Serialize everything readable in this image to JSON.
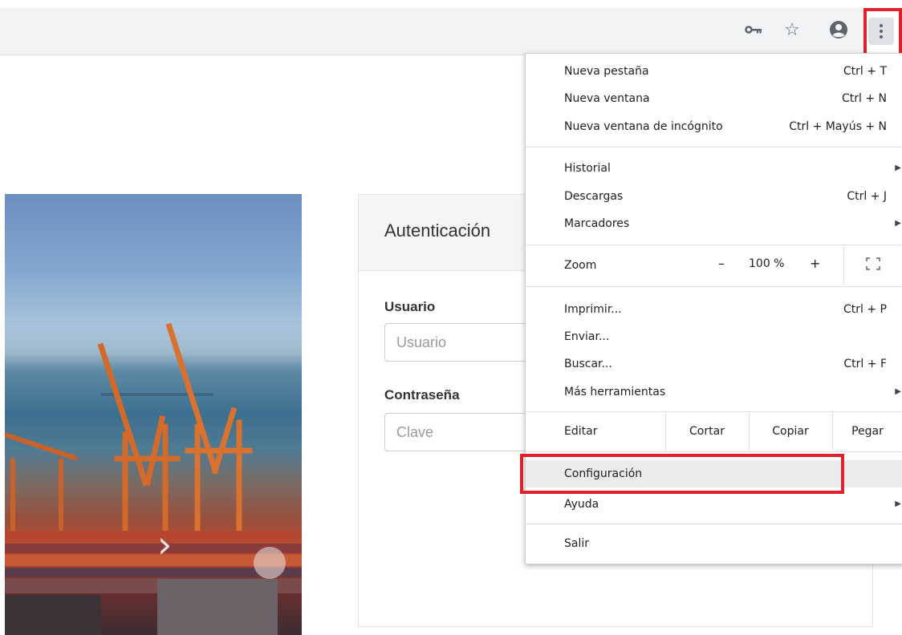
{
  "browser": {
    "icons": [
      "key-icon",
      "star-icon",
      "account-icon",
      "more-vert-icon"
    ]
  },
  "login": {
    "title": "Autenticación",
    "user_label": "Usuario",
    "user_placeholder": "Usuario",
    "password_label": "Contraseña",
    "password_placeholder": "Clave"
  },
  "menu": {
    "new_tab": "Nueva pestaña",
    "new_tab_sc": "Ctrl + T",
    "new_window": "Nueva ventana",
    "new_window_sc": "Ctrl + N",
    "incognito": "Nueva ventana de incógnito",
    "incognito_sc": "Ctrl + Mayús + N",
    "history": "Historial",
    "downloads": "Descargas",
    "downloads_sc": "Ctrl + J",
    "bookmarks": "Marcadores",
    "zoom": "Zoom",
    "zoom_minus": "–",
    "zoom_value": "100 %",
    "zoom_plus": "+",
    "print": "Imprimir...",
    "print_sc": "Ctrl + P",
    "cast": "Enviar...",
    "find": "Buscar...",
    "find_sc": "Ctrl + F",
    "more_tools": "Más herramientas",
    "edit": "Editar",
    "cut": "Cortar",
    "copy": "Copiar",
    "paste": "Pegar",
    "settings": "Configuración",
    "help": "Ayuda",
    "exit": "Salir"
  },
  "colors": {
    "highlight": "#e0202a",
    "menu_hover": "#ebebeb"
  }
}
